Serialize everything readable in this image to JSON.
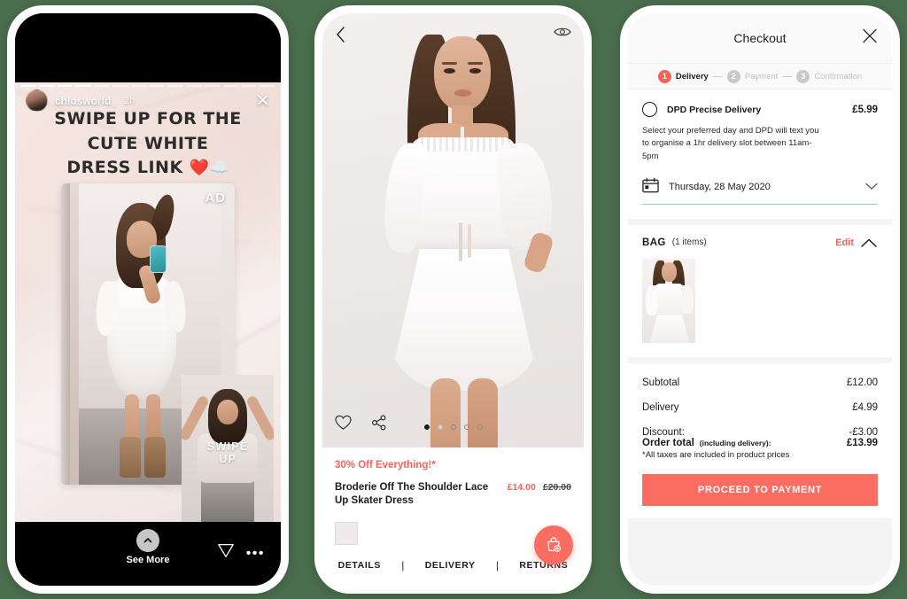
{
  "story": {
    "progress_segments": 14,
    "progress_done": 4,
    "username": "chlosworld_",
    "timestamp": "2h",
    "close_icon": "close-icon",
    "caption_line1": "SWIPE UP FOR THE CUTE WHITE",
    "caption_line2": "DRESS LINK",
    "caption_emoji": "❤️☁️",
    "ad_label": "AD",
    "overlay_text_line1": "SWIPE",
    "overlay_text_line2": "UP",
    "see_more_label": "See More",
    "see_more_icon": "chevron-up-circle-icon",
    "send_icon": "send-icon",
    "more_icon": "more-dots-icon"
  },
  "pdp": {
    "back_icon": "chevron-left-icon",
    "eye_icon": "eye-icon",
    "like_icon": "heart-icon",
    "share_icon": "share-icon",
    "fab_icon": "add-to-bag-icon",
    "promo": "30% Off Everything!*",
    "title": "Broderie Off The Shoulder Lace Up Skater Dress",
    "price": "£14.00",
    "price_old": "£20.00",
    "swatch_color": "#f0eaec",
    "carousel_dots": 5,
    "carousel_active": 0,
    "tabs": [
      {
        "label": "DETAILS"
      },
      {
        "label": "DELIVERY"
      },
      {
        "label": "RETURNS"
      }
    ],
    "tab_separator": "|"
  },
  "checkout": {
    "title": "Checkout",
    "close_icon": "close-icon",
    "steps": [
      {
        "number": "1",
        "label": "Delivery",
        "active": true
      },
      {
        "number": "2",
        "label": "Payment",
        "active": false
      },
      {
        "number": "3",
        "label": "Confirmation",
        "active": false
      }
    ],
    "delivery": {
      "radio_icon": "radio-unchecked-icon",
      "name": "DPD Precise Delivery",
      "price": "£5.99",
      "description": "Select your preferred day and DPD will text you to organise a 1hr delivery slot between 11am-5pm",
      "calendar_icon": "calendar-icon",
      "date_value": "Thursday, 28 May 2020",
      "chevron_icon": "chevron-down-icon",
      "underline_color": "#7fd0cb"
    },
    "bag": {
      "label": "BAG",
      "count": "(1 items)",
      "edit_label": "Edit",
      "collapse_icon": "chevron-up-icon"
    },
    "summary": {
      "rows": [
        {
          "label": "Subtotal",
          "value": "£12.00"
        },
        {
          "label": "Delivery",
          "value": "£4.99"
        },
        {
          "label": "Discount:",
          "value": "-£3.00"
        }
      ],
      "total_label": "Order total",
      "total_note": "(including delivery):",
      "total_value": "£13.99",
      "tax_note": "*All taxes are included in product prices"
    },
    "cta_label": "PROCEED TO PAYMENT",
    "accent_color": "#fb6d63"
  }
}
